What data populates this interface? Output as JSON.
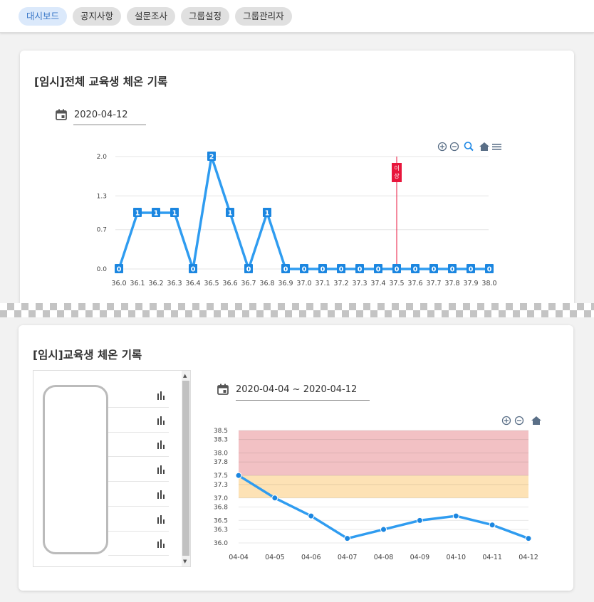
{
  "nav": {
    "tabs": [
      {
        "label": "대시보드",
        "active": true
      },
      {
        "label": "공지사항",
        "active": false
      },
      {
        "label": "설문조사",
        "active": false
      },
      {
        "label": "그룹설정",
        "active": false
      },
      {
        "label": "그룹관리자",
        "active": false
      }
    ]
  },
  "card1": {
    "title": "[임시]전체 교육생 체온 기록",
    "date": "2020-04-12",
    "toolbar_icons": [
      "zoom-in-icon",
      "zoom-out-icon",
      "zoom-select-icon",
      "home-icon",
      "menu-icon"
    ],
    "marker_label": "이상"
  },
  "card2": {
    "title": "[임시]교육생 체온 기록",
    "date_range": "2020-04-04 ~ 2020-04-12",
    "toolbar_icons": [
      "zoom-in-icon",
      "zoom-out-icon",
      "home-icon"
    ],
    "list_rows": 7
  },
  "colors": {
    "line": "#2f9cf0",
    "marker": "#e8163c",
    "danger_band": "#f2c1c4",
    "warning_band": "#fde2b5",
    "chip_active_bg": "#dbe9fb",
    "chip_active_text": "#3a78c8"
  },
  "chart_data": [
    {
      "type": "line",
      "categories": [
        "36.0",
        "36.1",
        "36.2",
        "36.3",
        "36.4",
        "36.5",
        "36.6",
        "36.7",
        "36.8",
        "36.9",
        "37.0",
        "37.1",
        "37.2",
        "37.3",
        "37.4",
        "37.5",
        "37.6",
        "37.7",
        "37.8",
        "37.9",
        "38.0"
      ],
      "values": [
        0,
        1,
        1,
        1,
        0,
        2,
        1,
        0,
        1,
        0,
        0,
        0,
        0,
        0,
        0,
        0,
        0,
        0,
        0,
        0,
        0
      ],
      "y_ticks": [
        "0.0",
        "0.7",
        "1.3",
        "2.0"
      ],
      "ylim": [
        0,
        2
      ],
      "vertical_marker": {
        "category": "37.5",
        "label": "이상"
      },
      "data_labels": true,
      "grid": true
    },
    {
      "type": "line",
      "categories": [
        "04-04",
        "04-05",
        "04-06",
        "04-07",
        "04-08",
        "04-09",
        "04-10",
        "04-11",
        "04-12"
      ],
      "values": [
        37.5,
        37.0,
        36.6,
        36.1,
        36.3,
        36.5,
        36.6,
        36.4,
        36.1
      ],
      "y_ticks": [
        "36.0",
        "36.3",
        "36.5",
        "36.8",
        "37.0",
        "37.3",
        "37.5",
        "37.8",
        "38.0",
        "38.3",
        "38.5"
      ],
      "ylim": [
        36.0,
        38.5
      ],
      "bands": [
        {
          "from": 37.5,
          "to": 38.5,
          "color": "danger"
        },
        {
          "from": 37.0,
          "to": 37.5,
          "color": "warning"
        }
      ],
      "grid": true
    }
  ]
}
